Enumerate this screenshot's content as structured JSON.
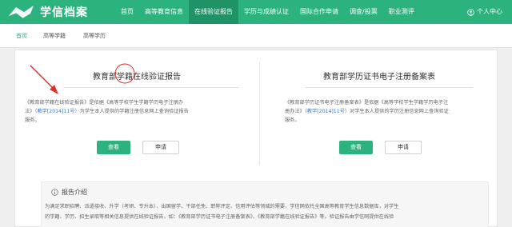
{
  "header": {
    "logo_text": "学信档案",
    "nav": [
      "首页",
      "高等教育信息",
      "在线验证报告",
      "学历与成绩认证",
      "国际合作申请",
      "调查/投票",
      "职业测评"
    ],
    "user_label": "个人中心"
  },
  "subnav": [
    "首页",
    "高等学籍",
    "高等学历"
  ],
  "cards": [
    {
      "title": "教育部学籍在线验证报告",
      "text_1": "《教育部学籍在线验证报告》是依据《高等学校学生学籍学历电子注册办",
      "text_2a": "法》（",
      "text_2_link": "教学[2014]11号",
      "text_2b": "）为学生本人提供的学籍注册信息网上查询验证报告",
      "text_3": "服务。",
      "btn_view": "查看",
      "btn_apply": "申请"
    },
    {
      "title": "教育部学历证书电子注册备案表",
      "text_1": "《教育部学历证书电子注册备案表》是依据《高等学校学生学籍学历电子注",
      "text_2a": "册办法》（",
      "text_2_link": "教学[2014]11号",
      "text_2b": "）对学生本人提供的学历注册信息网上查询验证",
      "text_3": "服务。",
      "btn_view": "查看",
      "btn_apply": "申请"
    }
  ],
  "intro": {
    "title": "报告介绍",
    "line_1": "为满足求职招聘、派遣接收、升学（考研、专升本）、出国留学、干部任免、职称评定、信用评估等领域的需要，学信网依托全国高等教育学生信息数据库，对学生",
    "line_2": "的学籍、学历、招生录取等相关信息提供在线验证报告，如：《教育部学历证书电子注册备案表》、《教育部学籍在线验证报告》等。验证报告由学信网提供在线验"
  },
  "colors": {
    "brand": "#2bb27d",
    "nav_active": "#1f9266",
    "link": "#2b7bd6",
    "annotation": "#e0302a"
  },
  "icons": {
    "logo": "logo-book-icon",
    "user": "user-icon",
    "intro": "info-icon"
  }
}
